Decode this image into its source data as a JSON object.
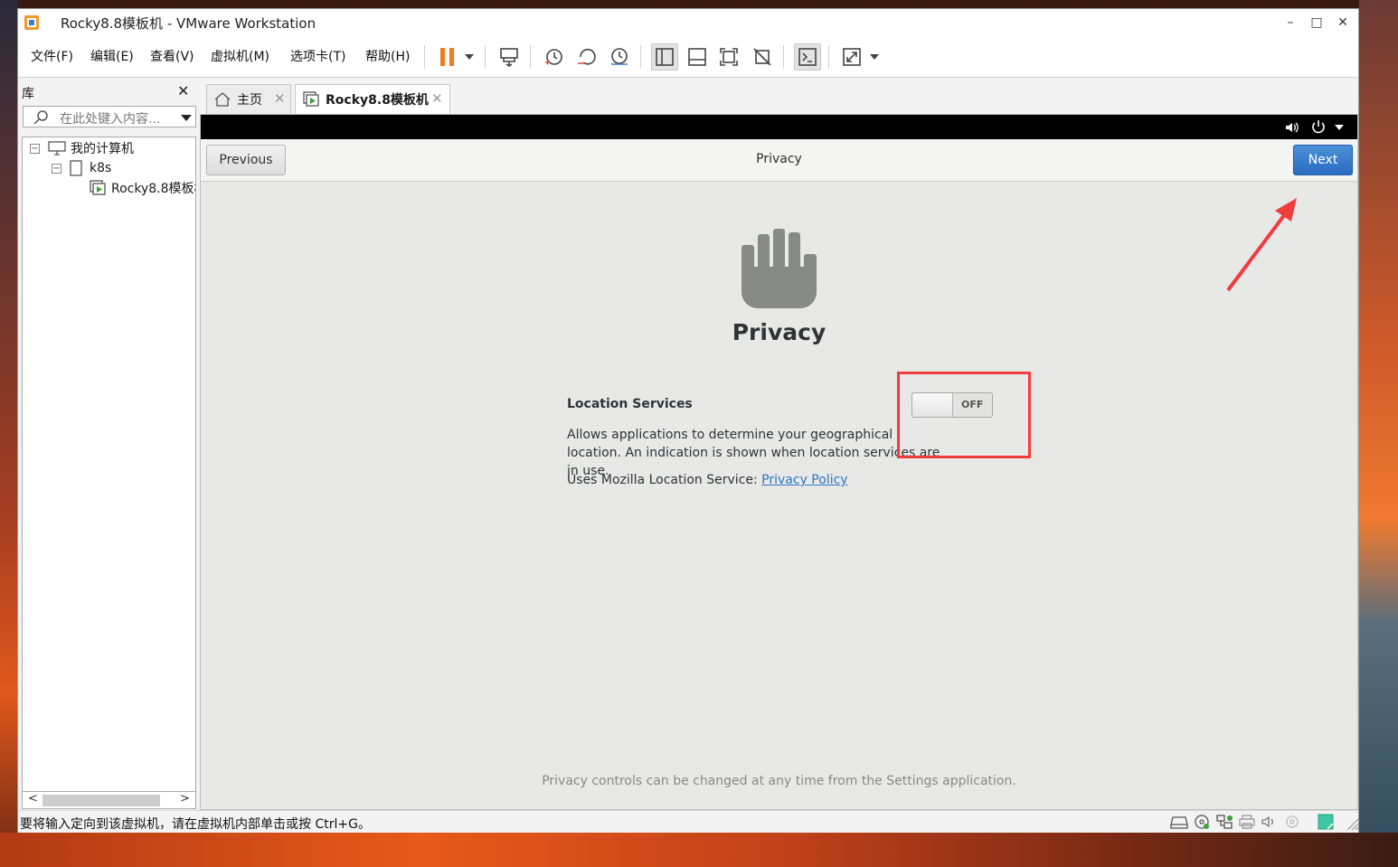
{
  "window": {
    "title": "Rocky8.8模板机 - VMware Workstation",
    "controls": {
      "minimize": "–",
      "maximize": "□",
      "close": "✕"
    }
  },
  "menu": [
    "文件(F)",
    "编辑(E)",
    "查看(V)",
    "虚拟机(M)",
    "选项卡(T)",
    "帮助(H)"
  ],
  "library": {
    "title": "库",
    "close": "✕",
    "search_placeholder": "在此处键入内容...",
    "tree": {
      "root": "我的计算机",
      "folder": "k8s",
      "vm": "Rocky8.8模板机"
    },
    "scroll_left": "<",
    "scroll_right": ">"
  },
  "tabs": [
    {
      "label": "主页",
      "close": "✕"
    },
    {
      "label": "Rocky8.8模板机",
      "close": "✕"
    }
  ],
  "vm_screen": {
    "header": {
      "previous": "Previous",
      "title": "Privacy",
      "next": "Next"
    },
    "heading": "Privacy",
    "location": {
      "label": "Location Services",
      "toggle_state": "OFF",
      "description": "Allows applications to determine your geographical location. An indication is shown when location services are in use.",
      "uses_prefix": "Uses Mozilla Location Service: ",
      "link": "Privacy Policy"
    },
    "footer": "Privacy controls can be changed at any time from the Settings application."
  },
  "status": {
    "text": "要将输入定向到该虚拟机，请在虚拟机内部单击或按 Ctrl+G。"
  },
  "colors": {
    "accent": "#2b6cc2",
    "annotation": "#ef3c3c",
    "pause": "#f07a1e"
  }
}
